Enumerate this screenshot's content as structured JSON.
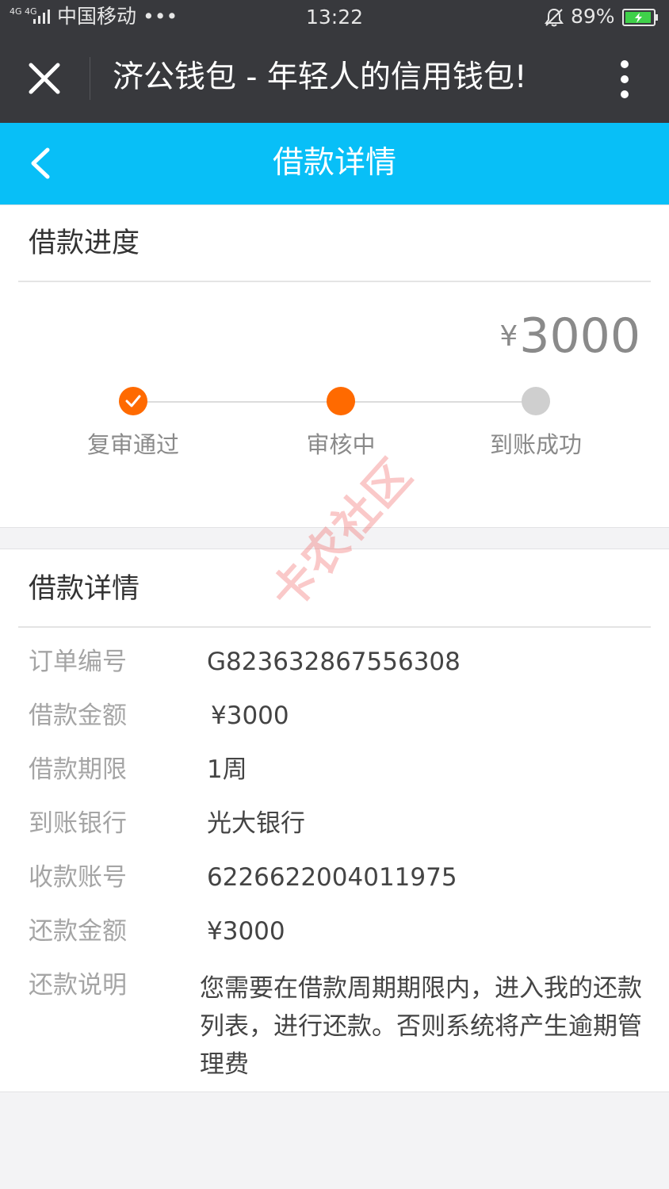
{
  "status_bar": {
    "network": "4G 4G",
    "carrier": "中国移动 •••",
    "time": "13:22",
    "battery": "89%",
    "battery_color": "#3fd14a"
  },
  "title_bar": {
    "title": "济公钱包 - 年轻人的信用钱包!"
  },
  "header": {
    "title": "借款详情",
    "color": "#08bff7"
  },
  "progress": {
    "section_title": "借款进度",
    "amount": "¥3000",
    "steps": [
      {
        "label": "复审通过",
        "state": "done"
      },
      {
        "label": "审核中",
        "state": "current"
      },
      {
        "label": "到账成功",
        "state": "pending"
      }
    ],
    "accent_color": "#ff6a00"
  },
  "details": {
    "section_title": "借款详情",
    "rows": [
      {
        "label": "订单编号",
        "value": "G823632867556308"
      },
      {
        "label": "借款金额",
        "value": "¥3000"
      },
      {
        "label": "借款期限",
        "value": "1周"
      },
      {
        "label": "到账银行",
        "value": "光大银行"
      },
      {
        "label": "收款账号",
        "value": "6226622004011975"
      },
      {
        "label": "还款金额",
        "value": "¥3000"
      },
      {
        "label": "还款说明",
        "value": "您需要在借款周期期限内，进入我的还款列表，进行还款。否则系统将产生逾期管理费"
      }
    ]
  },
  "watermark": "卡农社区"
}
